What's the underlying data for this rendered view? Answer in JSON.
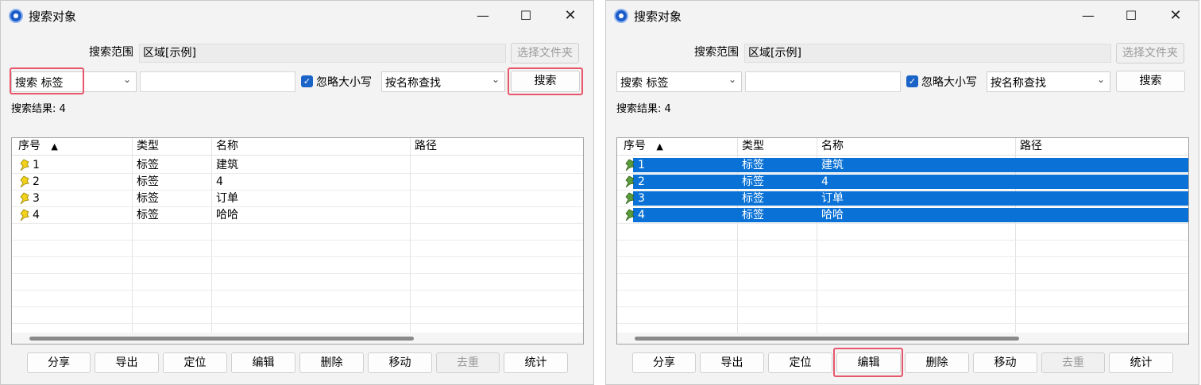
{
  "windows": [
    {
      "title": "搜索对象",
      "scope_label": "搜索范围",
      "scope_value": "区域[示例]",
      "choose_folder_label": "选择文件夹",
      "search_type_value": "搜索 标签",
      "search_text_value": "",
      "ignore_case_label": "忽略大小写",
      "ignore_case_checked": true,
      "search_mode_value": "按名称查找",
      "search_button_label": "搜索",
      "results_label": "搜索结果: 4",
      "columns": [
        "序号",
        "类型",
        "名称",
        "路径"
      ],
      "sort_indicator": "▲",
      "rows": [
        {
          "index": "1",
          "type": "标签",
          "name": "建筑",
          "path": ""
        },
        {
          "index": "2",
          "type": "标签",
          "name": "4",
          "path": ""
        },
        {
          "index": "3",
          "type": "标签",
          "name": "订单",
          "path": ""
        },
        {
          "index": "4",
          "type": "标签",
          "name": "哈哈",
          "path": ""
        }
      ],
      "rows_selected": false,
      "buttons": [
        "分享",
        "导出",
        "定位",
        "编辑",
        "删除",
        "移动",
        "去重",
        "统计"
      ],
      "disabled_button": "去重",
      "highlighted": [
        "search-type",
        "search-button"
      ]
    },
    {
      "title": "搜索对象",
      "scope_label": "搜索范围",
      "scope_value": "区域[示例]",
      "choose_folder_label": "选择文件夹",
      "search_type_value": "搜索 标签",
      "search_text_value": "",
      "ignore_case_label": "忽略大小写",
      "ignore_case_checked": true,
      "search_mode_value": "按名称查找",
      "search_button_label": "搜索",
      "results_label": "搜索结果: 4",
      "columns": [
        "序号",
        "类型",
        "名称",
        "路径"
      ],
      "sort_indicator": "▲",
      "rows": [
        {
          "index": "1",
          "type": "标签",
          "name": "建筑",
          "path": ""
        },
        {
          "index": "2",
          "type": "标签",
          "name": "4",
          "path": ""
        },
        {
          "index": "3",
          "type": "标签",
          "name": "订单",
          "path": ""
        },
        {
          "index": "4",
          "type": "标签",
          "name": "哈哈",
          "path": ""
        }
      ],
      "rows_selected": true,
      "buttons": [
        "分享",
        "导出",
        "定位",
        "编辑",
        "删除",
        "移动",
        "去重",
        "统计"
      ],
      "disabled_button": "去重",
      "highlighted": [
        "edit-button"
      ]
    }
  ],
  "colors": {
    "selection": "#0a72d6",
    "highlight_box": "#e8566b",
    "pin_yellow": "#f2d21b",
    "pin_green": "#5a9b3a",
    "checkbox": "#1a64c8"
  },
  "icons": {
    "app": "app-logo-icon",
    "pin": "pushpin-icon",
    "dropdown": "chevron-down-icon",
    "check": "checkmark-icon"
  }
}
